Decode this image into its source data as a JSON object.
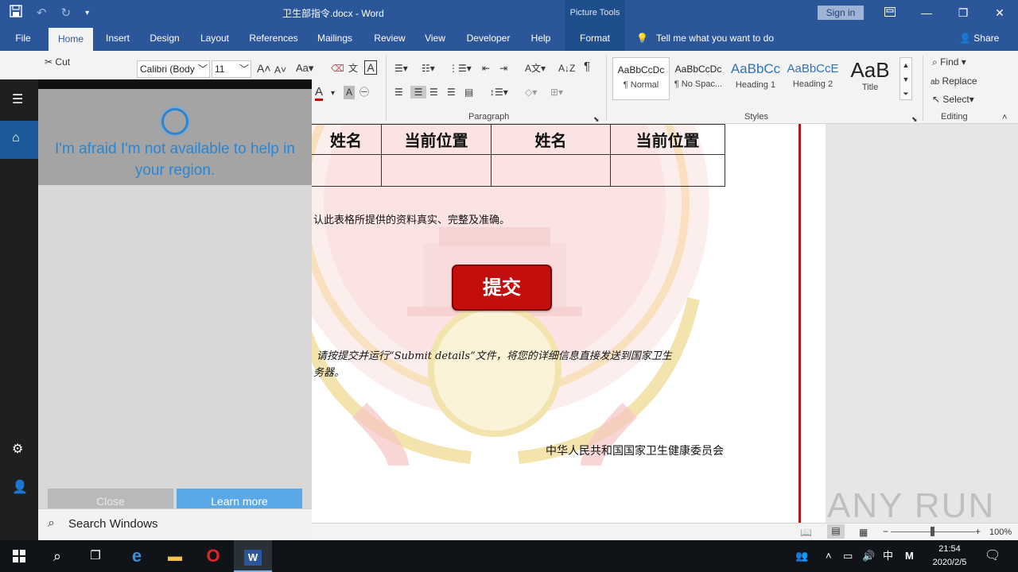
{
  "window": {
    "title": "卫生部指令.docx  -  Word",
    "picture_tools": "Picture Tools",
    "sign_in": "Sign in"
  },
  "tabs": [
    "File",
    "Home",
    "Insert",
    "Design",
    "Layout",
    "References",
    "Mailings",
    "Review",
    "View",
    "Developer",
    "Help",
    "Format"
  ],
  "tell_me": "Tell me what you want to do",
  "share": "Share",
  "ribbon": {
    "clipboard": {
      "cut": "Cut"
    },
    "font": {
      "name": "Calibri (Body",
      "size": "11"
    },
    "paragraph_label": "Paragraph",
    "styles_label": "Styles",
    "editing_label": "Editing",
    "styles": [
      {
        "sample": "AaBbCcDc",
        "name": "¶ Normal"
      },
      {
        "sample": "AaBbCcDc",
        "name": "¶ No Spac..."
      },
      {
        "sample": "AaBbCc",
        "name": "Heading 1"
      },
      {
        "sample": "AaBbCcE",
        "name": "Heading 2"
      },
      {
        "sample": "AaB",
        "name": "Title"
      }
    ],
    "editing": {
      "find": "Find",
      "replace": "Replace",
      "select": "Select"
    }
  },
  "document": {
    "table_headers": [
      "姓名",
      "当前位置",
      "姓名",
      "当前位置"
    ],
    "confirm_text": "认此表格所提供的资料真实、完整及准确。",
    "submit_label": "提交",
    "instruction_line1": "请按提交并运行“Submit details”文件，将您的详细信息直接发送到国家卫生",
    "instruction_line2": "务器。",
    "footer_org": "中华人民共和国国家卫生健康委员会"
  },
  "status": {
    "zoom": "100%"
  },
  "cortana": {
    "message": "I'm afraid I'm not available to help in your region.",
    "close_button": "Close",
    "learn_more_button": "Learn more",
    "search_placeholder": "Search Windows"
  },
  "taskbar": {
    "time": "21:54",
    "date": "2020/2/5",
    "ime_lang": "中",
    "ime_mode": "M"
  },
  "watermark": "ANY RUN"
}
